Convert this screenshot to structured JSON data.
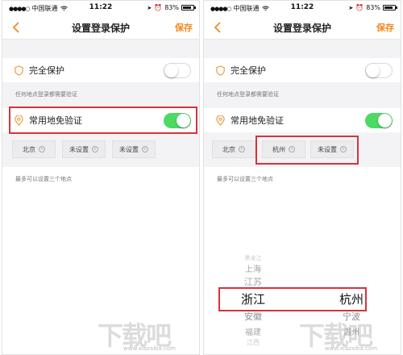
{
  "status_bar": {
    "carrier": "中国联通",
    "time": "11:22",
    "battery": "83%",
    "battery_level": 0.83
  },
  "nav": {
    "title": "设置登录保护",
    "save_label": "保存"
  },
  "full_protection": {
    "label": "完全保护",
    "enabled": false
  },
  "hint_all_places": "任何地点登录都需要验证",
  "common_location": {
    "label": "常用地免验证",
    "enabled": true
  },
  "limit_hint": "最多可以设置三个地点",
  "left_screen": {
    "chips": [
      "北京",
      "未设置",
      "未设置"
    ]
  },
  "right_screen": {
    "chips": [
      "北京",
      "杭州",
      "未设置"
    ],
    "picker": {
      "province_items": [
        "黑龙江",
        "上海",
        "江苏",
        "浙江",
        "安徽",
        "福建",
        "江西"
      ],
      "city_items": [
        "杭州",
        "宁波",
        "温州"
      ],
      "selected_province": "浙江",
      "selected_city": "杭州"
    }
  },
  "colors": {
    "accent": "#f08a24",
    "toggle_on": "#4cd964",
    "highlight_box": "#d6333a"
  },
  "watermark": {
    "text": "下载吧",
    "url": "www.xiazaiba.com"
  }
}
